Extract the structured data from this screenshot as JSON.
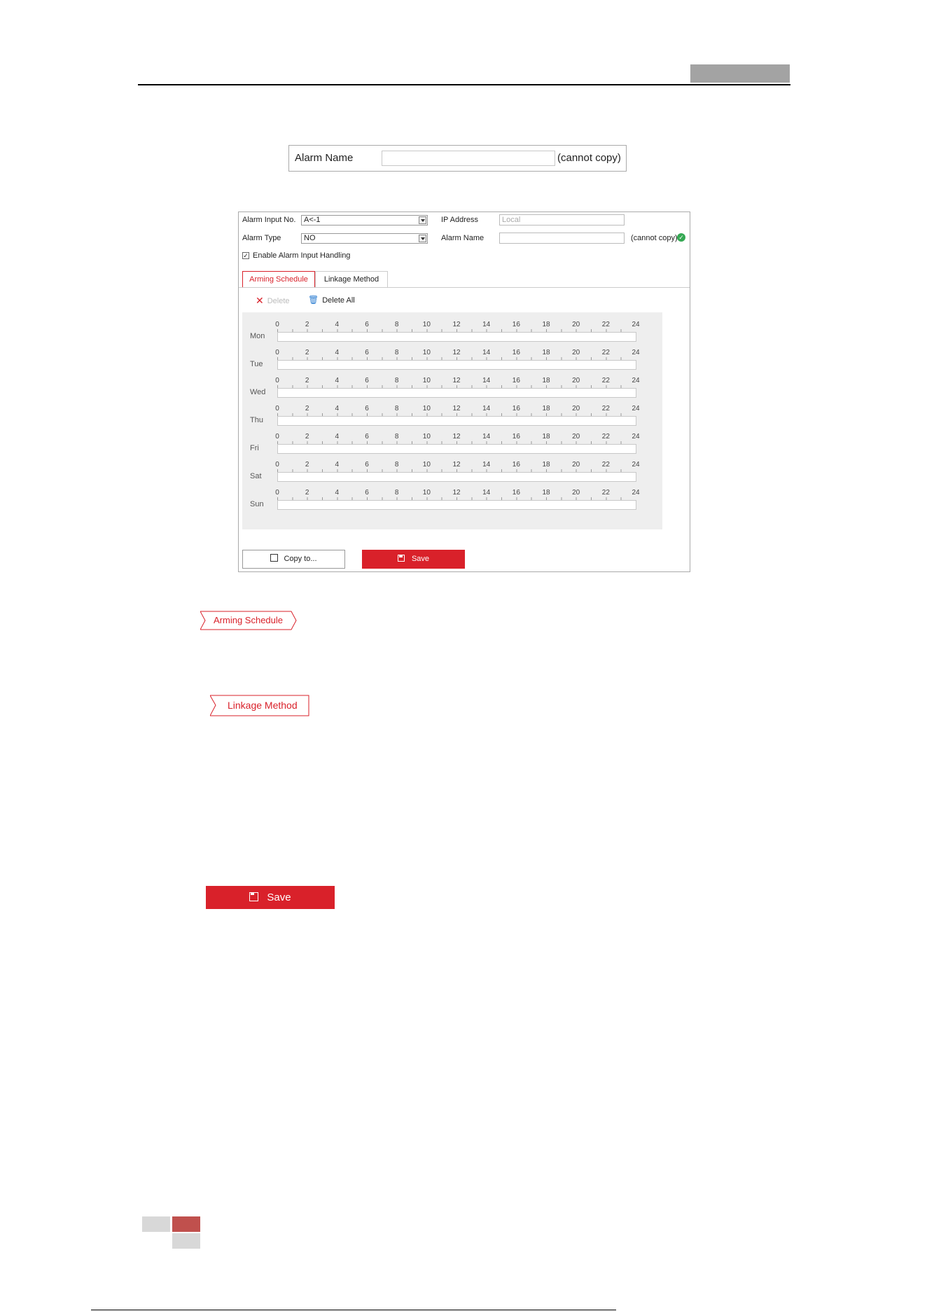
{
  "alarm_name_box": {
    "label": "Alarm Name",
    "value": "",
    "note": "(cannot copy)"
  },
  "panel": {
    "alarm_input_no_label": "Alarm Input No.",
    "alarm_input_no_value": "A<-1",
    "ip_address_label": "IP Address",
    "ip_address_value": "Local",
    "alarm_type_label": "Alarm Type",
    "alarm_type_value": "NO",
    "alarm_name_label": "Alarm Name",
    "alarm_name_value": "",
    "alarm_name_note": "(cannot copy)",
    "enable_label": "Enable Alarm Input Handling",
    "enable_checked": true,
    "tabs": [
      {
        "label": "Arming Schedule",
        "active": true
      },
      {
        "label": "Linkage Method",
        "active": false
      }
    ],
    "toolbar": {
      "delete_label": "Delete",
      "delete_all_label": "Delete All"
    },
    "schedule": {
      "hours": [
        "0",
        "2",
        "4",
        "6",
        "8",
        "10",
        "12",
        "14",
        "16",
        "18",
        "20",
        "22",
        "24"
      ],
      "days": [
        "Mon",
        "Tue",
        "Wed",
        "Thu",
        "Fri",
        "Sat",
        "Sun"
      ]
    },
    "copy_label": "Copy to...",
    "save_label": "Save"
  },
  "standalone": {
    "arming_schedule_tab": "Arming Schedule",
    "linkage_method_tab": "Linkage Method",
    "save_button": "Save"
  },
  "colors": {
    "accent": "#d9212a",
    "ok_green": "#35a853",
    "footer_red": "#c0504d"
  }
}
